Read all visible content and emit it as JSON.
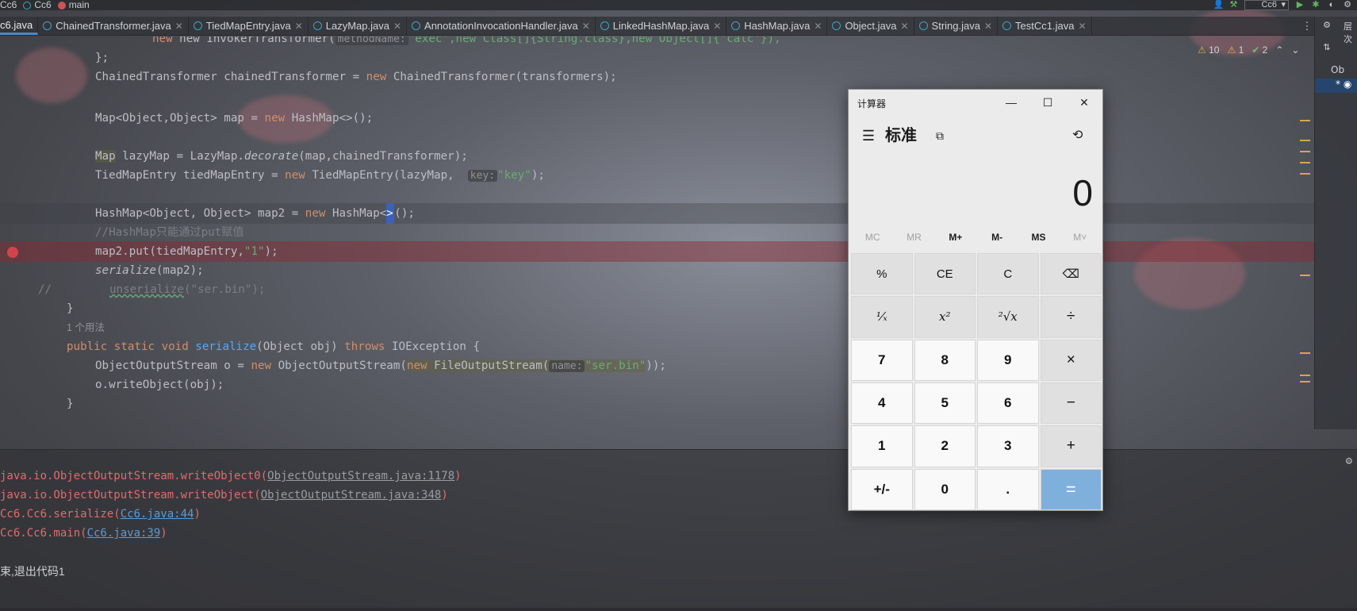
{
  "topbar": {
    "crumbs": [
      {
        "label": "Cc6",
        "icon": "class-icon"
      },
      {
        "label": "Cc6",
        "icon": "class-icon"
      },
      {
        "label": "main",
        "icon": "method-icon"
      }
    ],
    "run_config": "Cc6"
  },
  "tabs": [
    {
      "label": "c6.java",
      "active": true
    },
    {
      "label": "ChainedTransformer.java"
    },
    {
      "label": "TiedMapEntry.java"
    },
    {
      "label": "LazyMap.java"
    },
    {
      "label": "AnnotationInvocationHandler.java"
    },
    {
      "label": "LinkedHashMap.java"
    },
    {
      "label": "HashMap.java"
    },
    {
      "label": "Object.java"
    },
    {
      "label": "String.java"
    },
    {
      "label": "TestCc1.java"
    }
  ],
  "right_strip": {
    "label": "层次",
    "sub": "Ob"
  },
  "inspections": {
    "warnings": "10",
    "weak": "1",
    "ok": "2"
  },
  "code": {
    "l1": {
      "a": "new InvokerTransformer(",
      "hint": "methodName:",
      "b": "\"exec\",new Class[]{String.class},new Object[]{\"calc\"}),"
    },
    "l2": "};",
    "l3": {
      "a": "ChainedTransformer chainedTransformer = ",
      "kw": "new",
      "b": " ChainedTransformer(transformers);"
    },
    "l4": {
      "a": "Map<Object,Object> map = ",
      "kw": "new",
      "b": " HashMap<>();"
    },
    "l5": {
      "a": "Map",
      "b": " lazyMap = LazyMap.",
      "c": "decorate",
      "d": "(map,chainedTransformer);"
    },
    "l6": {
      "a": "TiedMapEntry tiedMapEntry = ",
      "kw": "new",
      "b": " TiedMapEntry(lazyMap,  ",
      "hint": "key:",
      "s": "\"key\"",
      "c": ");"
    },
    "l7": {
      "a": "HashMap<Object, Object> map2 = ",
      "kw": "new",
      "b": " HashMap<",
      "caret": ">",
      "c": "();"
    },
    "l8": "//HashMap只能通过put赋值",
    "l9": {
      "a": "map2.put(tiedMapEntry,",
      "s": "\"1\"",
      "b": ");"
    },
    "l10": {
      "a": "serialize",
      "b": "(map2);"
    },
    "l11": {
      "a": "//",
      "b": "unserialize",
      "c": "(\"ser.bin\");"
    },
    "l12": "}",
    "l13": "1 个用法",
    "l14": {
      "kw": "public static void",
      "a": "serialize",
      "b": "(Object obj) ",
      "kw2": "throws",
      "c": " IOException {"
    },
    "l15": {
      "a": "ObjectOutputStream o = ",
      "kw": "new",
      "b": " ObjectOutputStream(",
      "kw2": "new",
      "c": " FileOutputStream(",
      "hint": "name:",
      "s": "\"ser.bin\"",
      "d": "));"
    },
    "l16": "o.writeObject(obj);",
    "l17": "}"
  },
  "run_output": [
    {
      "a": "java.io.ObjectOutputStream.writeObject0(",
      "link": "ObjectOutputStream.java:1178",
      "b": ")",
      "grey": true
    },
    {
      "a": "java.io.ObjectOutputStream.writeObject(",
      "link": "ObjectOutputStream.java:348",
      "b": ")",
      "grey": true
    },
    {
      "a": "Cc6.Cc6.serialize(",
      "link": "Cc6.java:44",
      "b": ")"
    },
    {
      "a": "Cc6.Cc6.main(",
      "link": "Cc6.java:39",
      "b": ")"
    }
  ],
  "exit_text": "束,退出代码1",
  "calculator": {
    "title": "计算器",
    "mode": "标准",
    "display": "0",
    "memory": [
      "MC",
      "MR",
      "M+",
      "M-",
      "MS",
      "M˅"
    ],
    "keys": [
      {
        "label": "%",
        "type": "op-s"
      },
      {
        "label": "CE",
        "type": "op-s"
      },
      {
        "label": "C",
        "type": "op-s"
      },
      {
        "label": "⌫",
        "type": "op-s"
      },
      {
        "label": "¹⁄ₓ",
        "type": "func"
      },
      {
        "label": "x²",
        "type": "func"
      },
      {
        "label": "²√x",
        "type": "func"
      },
      {
        "label": "÷",
        "type": "op"
      },
      {
        "label": "7",
        "type": "num"
      },
      {
        "label": "8",
        "type": "num"
      },
      {
        "label": "9",
        "type": "num"
      },
      {
        "label": "×",
        "type": "op"
      },
      {
        "label": "4",
        "type": "num"
      },
      {
        "label": "5",
        "type": "num"
      },
      {
        "label": "6",
        "type": "num"
      },
      {
        "label": "−",
        "type": "op"
      },
      {
        "label": "1",
        "type": "num"
      },
      {
        "label": "2",
        "type": "num"
      },
      {
        "label": "3",
        "type": "num"
      },
      {
        "label": "+",
        "type": "op"
      },
      {
        "label": "+/-",
        "type": "num"
      },
      {
        "label": "0",
        "type": "num"
      },
      {
        "label": ".",
        "type": "num"
      },
      {
        "label": "=",
        "type": "equals"
      }
    ],
    "equals_color": "#7fb0dc"
  },
  "colors": {
    "keyword": "#cf8e6d",
    "string": "#6aab73",
    "breakpoint": "#d2444b",
    "error_text": "#e06c6c",
    "link": "#5b9bd5"
  }
}
